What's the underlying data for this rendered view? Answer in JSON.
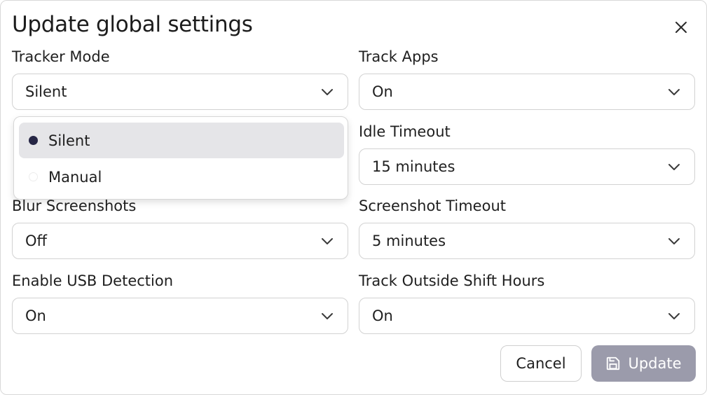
{
  "dialog": {
    "title": "Update global settings",
    "close_icon": "close-icon"
  },
  "fields": {
    "tracker_mode": {
      "label": "Tracker Mode",
      "value": "Silent"
    },
    "track_apps": {
      "label": "Track Apps",
      "value": "On"
    },
    "idle_timeout": {
      "label": "Idle Timeout",
      "value": "15 minutes"
    },
    "blur_screenshots": {
      "label": "Blur Screenshots",
      "value": "Off"
    },
    "screenshot_timeout": {
      "label": "Screenshot Timeout",
      "value": "5 minutes"
    },
    "usb_detection": {
      "label": "Enable USB Detection",
      "value": "On"
    },
    "track_outside_shift": {
      "label": "Track Outside Shift Hours",
      "value": "On"
    }
  },
  "tracker_mode_dropdown": {
    "options": [
      {
        "label": "Silent",
        "selected": true
      },
      {
        "label": "Manual",
        "selected": false
      }
    ]
  },
  "buttons": {
    "cancel_label": "Cancel",
    "update_label": "Update",
    "update_icon": "save-icon"
  },
  "colors": {
    "update_button_bg": "#9b9bab",
    "selected_option_bg": "#e5e5e8",
    "selected_radio": "#262645"
  }
}
